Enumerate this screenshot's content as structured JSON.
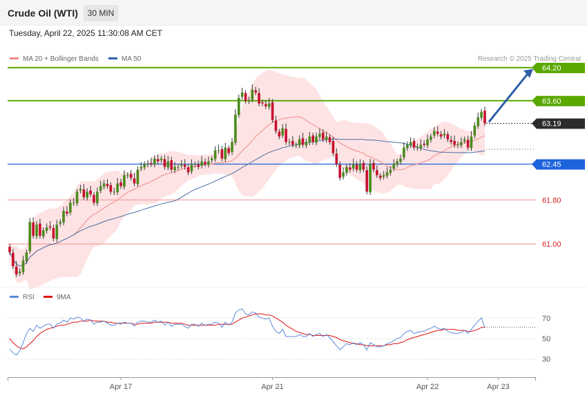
{
  "header": {
    "title": "Crude Oil (WTI)",
    "timeframe": "30 MIN"
  },
  "timestamp": "Tuesday, April 22, 2025 11:30:08 AM CET",
  "legend": {
    "ma20": "MA 20 + Bollinger Bands",
    "ma50": "MA 50",
    "credit": "Research © 2025 Trading Central"
  },
  "rsi_legend": {
    "rsi": "RSI",
    "ma": "9MA"
  },
  "colors": {
    "up": "#4a8a1c",
    "down": "#c8102e",
    "band": "#fde0e0",
    "ma20": "#f08a8a",
    "ma50": "#4a6fa5",
    "resistance": "#5aa800",
    "pivot": "#1e64dc",
    "support": "#f4a0a0",
    "arrow": "#2e5fa8"
  },
  "chart_data": [
    {
      "type": "candlestick",
      "ylim": [
        60.35,
        64.55
      ],
      "levels": [
        {
          "value": 64.2,
          "label": "64.20",
          "kind": "resistance"
        },
        {
          "value": 63.6,
          "label": "63.60",
          "kind": "resistance"
        },
        {
          "value": 63.19,
          "label": "63.19",
          "kind": "last"
        },
        {
          "value": 62.45,
          "label": "62.45",
          "kind": "pivot"
        },
        {
          "value": 61.8,
          "label": "61.80",
          "kind": "support"
        },
        {
          "value": 61.0,
          "label": "61.00",
          "kind": "support"
        }
      ],
      "x_ticks": [
        {
          "index": 33,
          "label": "Apr 17"
        },
        {
          "index": 78,
          "label": "Apr 21"
        },
        {
          "index": 124,
          "label": "Apr 22"
        },
        {
          "index": 145,
          "label": "Apr 23"
        }
      ],
      "close": [
        60.85,
        60.6,
        60.45,
        60.5,
        60.7,
        60.85,
        61.4,
        61.15,
        61.35,
        61.15,
        61.25,
        61.3,
        61.3,
        61.1,
        61.35,
        61.4,
        61.6,
        61.55,
        61.75,
        61.75,
        61.95,
        62.0,
        61.85,
        61.95,
        61.9,
        61.75,
        61.95,
        62.05,
        62.1,
        62.05,
        61.95,
        61.95,
        62.1,
        62.05,
        62.25,
        62.25,
        62.2,
        62.1,
        62.35,
        62.4,
        62.45,
        62.45,
        62.45,
        62.55,
        62.5,
        62.55,
        62.4,
        62.5,
        62.35,
        62.4,
        62.4,
        62.45,
        62.4,
        62.3,
        62.45,
        62.45,
        62.4,
        62.5,
        62.45,
        62.5,
        62.55,
        62.7,
        62.7,
        62.55,
        62.75,
        62.65,
        62.85,
        63.35,
        63.65,
        63.75,
        63.6,
        63.6,
        63.8,
        63.75,
        63.55,
        63.55,
        63.5,
        63.55,
        63.25,
        63.05,
        62.95,
        63.1,
        62.85,
        62.85,
        62.8,
        62.8,
        62.9,
        62.8,
        62.85,
        62.95,
        62.85,
        62.95,
        63.0,
        62.9,
        62.95,
        62.85,
        62.65,
        62.45,
        62.2,
        62.3,
        62.4,
        62.35,
        62.45,
        62.35,
        62.45,
        62.35,
        61.95,
        62.45,
        62.35,
        62.25,
        62.2,
        62.25,
        62.3,
        62.35,
        62.45,
        62.5,
        62.55,
        62.75,
        62.8,
        62.85,
        62.75,
        62.75,
        62.8,
        62.8,
        62.9,
        62.95,
        63.05,
        63.0,
        62.95,
        63.0,
        62.9,
        62.85,
        62.8,
        62.8,
        62.85,
        62.9,
        62.75,
        62.95,
        63.15,
        63.3,
        63.4,
        63.19
      ],
      "ma20_last": 62.9,
      "ma50_last": 62.72
    },
    {
      "type": "line",
      "ylim": [
        15,
        85
      ],
      "y_ticks": [
        70,
        50,
        30
      ],
      "series": [
        {
          "name": "RSI",
          "values": [
            40,
            36,
            34,
            38,
            46,
            55,
            60,
            57,
            63,
            60,
            62,
            64,
            64,
            60,
            64,
            65,
            68,
            66,
            70,
            69,
            71,
            70,
            67,
            69,
            68,
            64,
            66,
            66,
            67,
            65,
            63,
            63,
            65,
            64,
            66,
            65,
            65,
            62,
            66,
            67,
            67,
            66,
            66,
            68,
            66,
            67,
            63,
            66,
            62,
            64,
            64,
            64,
            62,
            60,
            64,
            64,
            62,
            65,
            63,
            64,
            64,
            66,
            65,
            61,
            66,
            63,
            66,
            75,
            78,
            79,
            74,
            73,
            76,
            75,
            71,
            70,
            69,
            70,
            62,
            57,
            55,
            59,
            52,
            52,
            52,
            52,
            54,
            52,
            52,
            55,
            52,
            54,
            55,
            52,
            54,
            51,
            47,
            43,
            39,
            42,
            45,
            44,
            46,
            44,
            46,
            44,
            39,
            46,
            44,
            42,
            42,
            43,
            45,
            46,
            48,
            50,
            51,
            55,
            57,
            58,
            55,
            56,
            57,
            57,
            59,
            60,
            62,
            60,
            59,
            60,
            57,
            56,
            55,
            55,
            56,
            58,
            55,
            59,
            63,
            67,
            70,
            61
          ]
        },
        {
          "name": "9MA",
          "values": [
            50,
            46,
            43,
            41,
            40,
            42,
            45,
            48,
            52,
            55,
            57,
            59,
            60,
            61,
            62,
            63,
            63,
            64,
            65,
            66,
            66,
            67,
            67,
            67,
            68,
            67,
            67,
            67,
            67,
            66,
            66,
            65,
            65,
            65,
            65,
            65,
            65,
            64,
            64,
            65,
            65,
            65,
            65,
            66,
            66,
            66,
            66,
            66,
            65,
            65,
            65,
            65,
            64,
            63,
            63,
            63,
            63,
            63,
            63,
            63,
            63,
            63,
            64,
            64,
            64,
            64,
            64,
            66,
            68,
            70,
            71,
            72,
            73,
            74,
            74,
            74,
            73,
            73,
            72,
            70,
            68,
            66,
            63,
            61,
            59,
            57,
            56,
            55,
            54,
            54,
            53,
            53,
            53,
            53,
            53,
            53,
            52,
            51,
            49,
            48,
            47,
            46,
            45,
            45,
            44,
            44,
            43,
            43,
            43,
            43,
            43,
            43,
            44,
            44,
            45,
            45,
            46,
            47,
            49,
            50,
            51,
            52,
            53,
            54,
            55,
            56,
            57,
            58,
            58,
            59,
            59,
            59,
            59,
            58,
            58,
            58,
            57,
            57,
            58,
            59,
            61,
            61
          ]
        }
      ]
    }
  ]
}
